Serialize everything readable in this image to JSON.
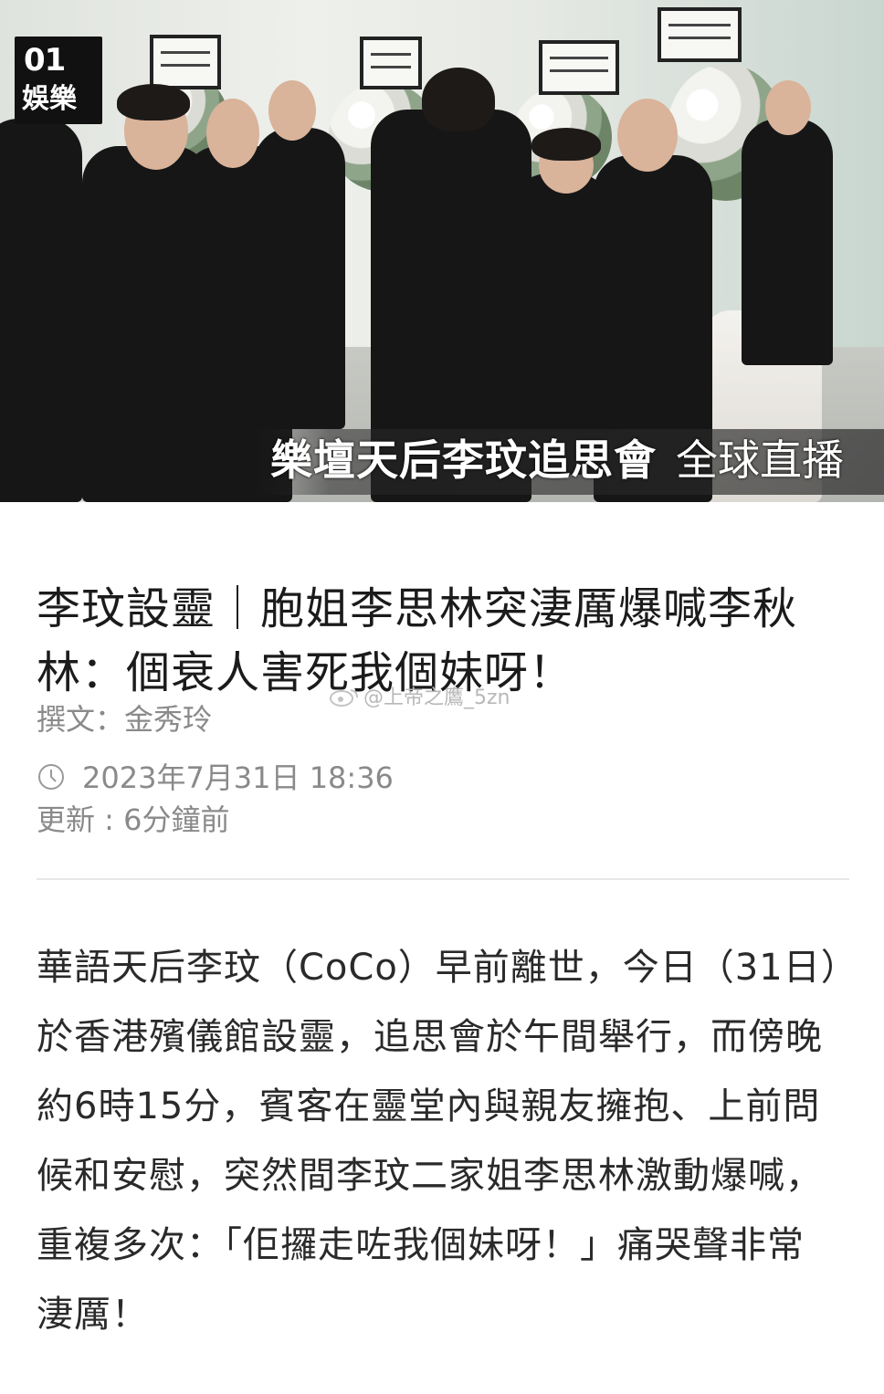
{
  "photo": {
    "logo_line1": "01",
    "logo_line2": "娛樂",
    "banner_strong": "樂壇天后李玟追思會",
    "banner_light": "全球直播"
  },
  "article": {
    "title": "李玟設靈｜胞姐李思林突淒厲爆喊李秋林：個衰人害死我個妹呀！",
    "author": "撰文：金秀玲",
    "published": "2023年7月31日 18:36",
    "updated": "更新 : 6分鐘前",
    "body": "華語天后李玟（CoCo）早前離世，今日（31日）於香港殯儀館設靈，追思會於午間舉行，而傍晚約6時15分，賓客在靈堂內與親友擁抱、上前問候和安慰，突然間李玟二家姐李思林激動爆喊，重複多次：「佢攞走咗我個妹呀！」痛哭聲非常淒厲！"
  },
  "watermark": "@上帝之鷹_5zn",
  "icons": {
    "clock": "clock-icon",
    "weibo": "weibo-logo-icon"
  }
}
